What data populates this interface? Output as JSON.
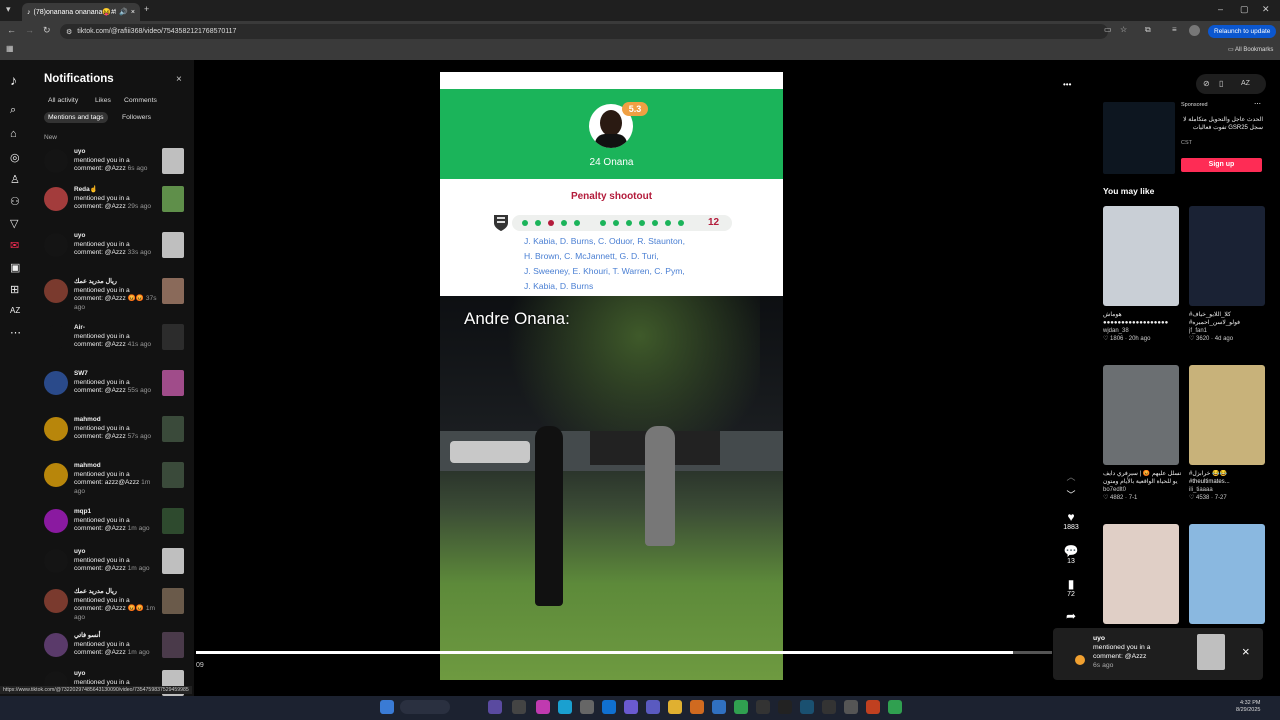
{
  "browser": {
    "tab_title": "(78)onanana onanana😝#f",
    "new_tab": "+",
    "url": "tiktok.com/@rafiii368/video/7543582121768570117",
    "relaunch_label": "Relaunch to update",
    "all_bookmarks": "All Bookmarks"
  },
  "notifications": {
    "title": "Notifications",
    "close": "×",
    "tabs": [
      "All activity",
      "Likes",
      "Comments",
      "Mentions and tags",
      "Followers"
    ],
    "section": "New",
    "items": [
      {
        "user": "uyo",
        "text": "mentioned you in a comment: @Azzz",
        "time": "6s ago",
        "avatar": "#141414",
        "thumb": "#bfbfbf"
      },
      {
        "user": "Reda☝️",
        "text": "mentioned you in a comment: @Azzz",
        "time": "29s ago",
        "avatar": "#a33c3c",
        "thumb": "#5f8f4a"
      },
      {
        "user": "uyo",
        "text": "mentioned you in a comment: @Azzz",
        "time": "33s ago",
        "avatar": "#141414",
        "thumb": "#bfbfbf"
      },
      {
        "user": "ريال مدريد عمك",
        "text": "mentioned you in a comment: @Azzz 😡😡",
        "time": "37s ago",
        "avatar": "#7a3a2e",
        "thumb": "#8a6a5a"
      },
      {
        "user": "Air-",
        "text": "mentioned you in a comment: @Azzz",
        "time": "41s ago",
        "avatar": "#121212",
        "thumb": "#2c2c2c"
      },
      {
        "user": "SW7",
        "text": "mentioned you in a comment: @Azzz",
        "time": "55s ago",
        "avatar": "#2a4a8a",
        "thumb": "#a04c8a"
      },
      {
        "user": "mahmod",
        "text": "mentioned you in a comment: @Azzz",
        "time": "57s ago",
        "avatar": "#b8860b",
        "thumb": "#3a4a3a"
      },
      {
        "user": "mahmod",
        "text": "mentioned you in a comment: azzz@Azzz",
        "time": "1m ago",
        "avatar": "#b8860b",
        "thumb": "#3a4a3a"
      },
      {
        "user": "mqp1",
        "text": "mentioned you in a comment: @Azzz",
        "time": "1m ago",
        "avatar": "#8a1aa0",
        "thumb": "#2e4a2e"
      },
      {
        "user": "uyo",
        "text": "mentioned you in a comment: @Azzz",
        "time": "1m ago",
        "avatar": "#141414",
        "thumb": "#bfbfbf"
      },
      {
        "user": "ريال مدريد عمك",
        "text": "mentioned you in a comment: @Azzz 😡😡",
        "time": "1m ago",
        "avatar": "#7a3a2e",
        "thumb": "#6a5a4a"
      },
      {
        "user": "أنسو فاتي",
        "text": "mentioned you in a comment: @Azzz",
        "time": "1m ago",
        "avatar": "#5a3a6a",
        "thumb": "#4a3a4a"
      },
      {
        "user": "uyo",
        "text": "mentioned you in a comment: @Azzz",
        "time": "",
        "avatar": "#141414",
        "thumb": "#bfbfbf"
      }
    ]
  },
  "video": {
    "rating": "5.3",
    "player": "24 Onana",
    "penalty_title": "Penalty shootout",
    "dots": [
      "g",
      "g",
      "r",
      "g",
      "g",
      "gap",
      "g",
      "g",
      "g",
      "g",
      "g",
      "g",
      "g"
    ],
    "count": "12",
    "name_lines": [
      "J. Kabia,  D. Burns,  C. Oduor,  R. Staunton,",
      "H. Brown,  C. McJannett,  G. D. Turi,",
      "J. Sweeney,  E. Khouri,  T. Warren,  C. Pym,",
      "J. Kabia,  D. Burns"
    ],
    "caption": "Andre Onana:",
    "progress": 0.955,
    "time": "09"
  },
  "actions": {
    "more": "•••",
    "likes": "1883",
    "comments": "13",
    "saves": "72"
  },
  "sidebar": {
    "sponsored": "Sponsored",
    "ad_text": "الحدث عاجل والتحويل متكاملة لا تفوت فعاليات GSR25 سجل",
    "ad_name": "CST",
    "signup": "Sign up",
    "you_may_like": "You may like",
    "videos": [
      {
        "title": "هوماش",
        "title2": "●●●●●●●●●●●●●●●●●●",
        "user": "wjdan_38",
        "stats": "♡ 1806 · 20h ago",
        "color": "#c9cfd6"
      },
      {
        "title": "#كلا_اللايو_خياف",
        "title2": "#فولو_لاسن_احميره",
        "user": "jf_fan1",
        "stats": "♡ 3620 · 4d ago",
        "color": "#1a2234"
      },
      {
        "title": "تسلل عليهم 😡 | سيرفري دايف",
        "title2": "يو للحياة الواقعية بالأيام ومتون",
        "user": "bo7edlt0",
        "stats": "♡ 4882 · 7-1",
        "color": "#6b6f72"
      },
      {
        "title": "#خرابزل 😂😂",
        "title2": "#theultimates...",
        "user": "ili_tiaaaa",
        "stats": "♡ 4538 · 7-27",
        "color": "#c8b27a"
      },
      {
        "title": "",
        "title2": "",
        "user": "",
        "stats": "",
        "color": "#e0cfc6"
      },
      {
        "title": "",
        "title2": "",
        "user": "",
        "stats": "",
        "color": "#8ab8e0"
      }
    ]
  },
  "toast": {
    "user": "uyo",
    "text1": "mentioned you in a",
    "text2": "comment: @Azzz",
    "time": "6s ago",
    "close": "×"
  },
  "status_url": "https://www.tiktok.com/@73220297485643130090/video/7354759837529459985",
  "clock": {
    "time": "4:32 PM",
    "date": "8/29/2025"
  },
  "colors": {
    "tiktok_red": "#fe2c55",
    "pitch_green": "#1bb45a",
    "penalty_red": "#b31b3b",
    "name_blue": "#4a7fd3"
  }
}
